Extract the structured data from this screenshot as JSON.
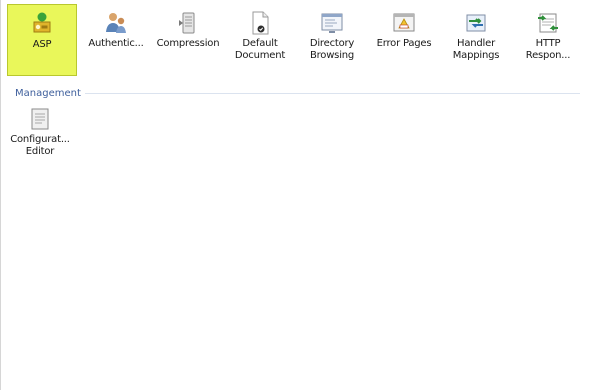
{
  "features": [
    {
      "label": "ASP",
      "icon": "asp-icon",
      "selected": true
    },
    {
      "label": "Authentic...",
      "icon": "authentication-icon",
      "selected": false
    },
    {
      "label": "Compression",
      "icon": "compression-icon",
      "selected": false
    },
    {
      "label": "Default\nDocument",
      "icon": "default-document-icon",
      "selected": false
    },
    {
      "label": "Directory\nBrowsing",
      "icon": "directory-browsing-icon",
      "selected": false
    },
    {
      "label": "Error Pages",
      "icon": "error-pages-icon",
      "selected": false
    },
    {
      "label": "Handler\nMappings",
      "icon": "handler-mappings-icon",
      "selected": false
    },
    {
      "label": "HTTP\nRespon...",
      "icon": "http-response-icon",
      "selected": false
    }
  ],
  "management": {
    "title": "Management",
    "items": [
      {
        "label": "Configurat...\nEditor",
        "icon": "configuration-editor-icon"
      }
    ]
  },
  "colors": {
    "selected_bg": "#e9f75a",
    "section_title": "#3e5f9c"
  }
}
